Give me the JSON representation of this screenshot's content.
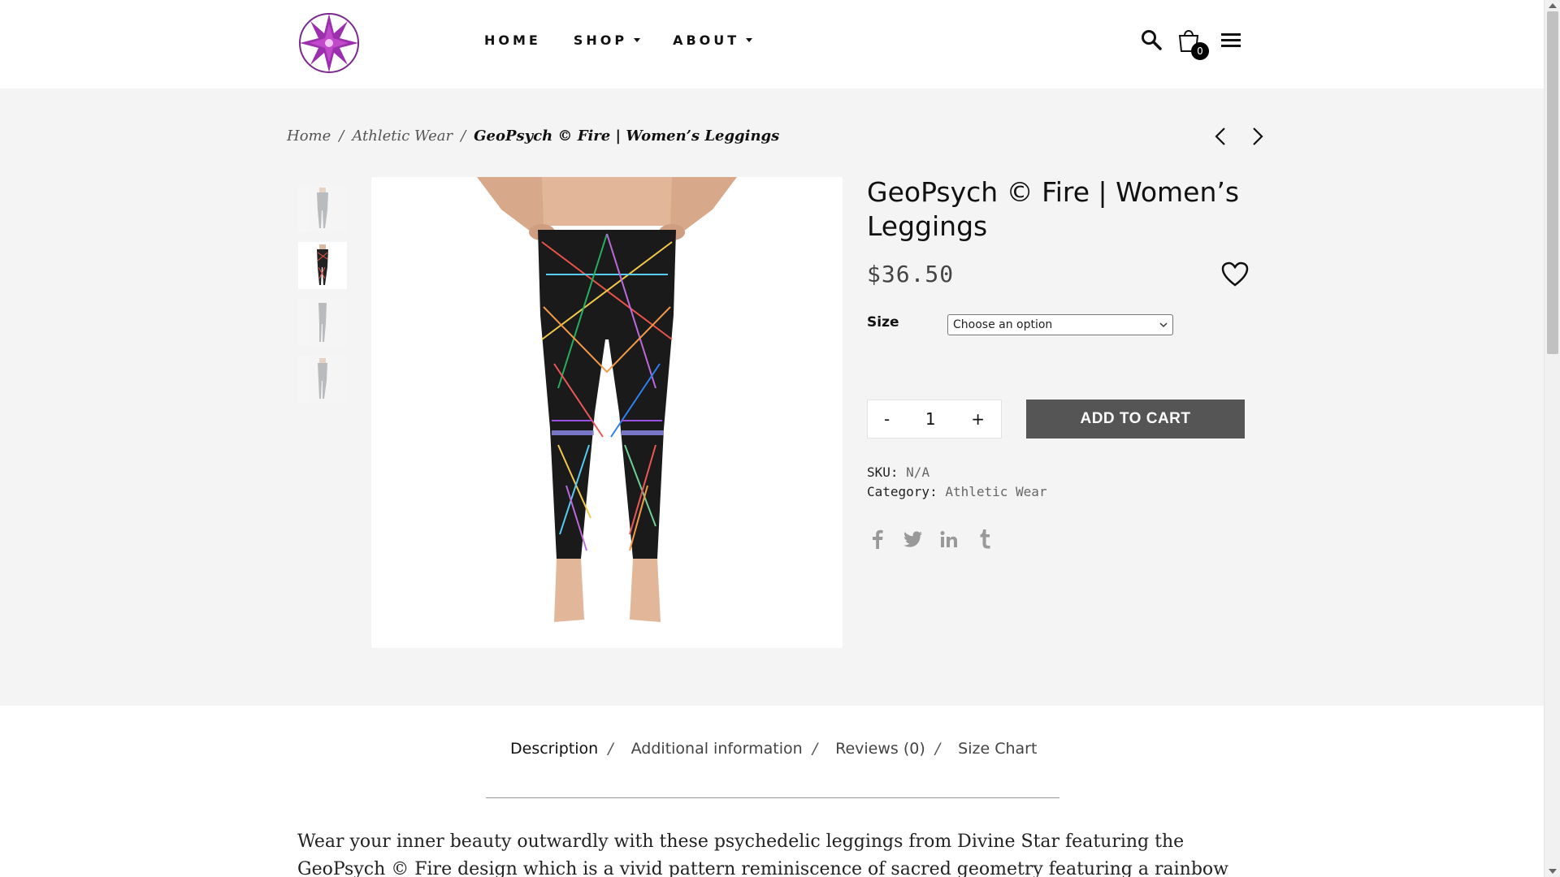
{
  "header": {
    "nav": [
      {
        "label": "HOME",
        "dropdown": false
      },
      {
        "label": "SHOP",
        "dropdown": true
      },
      {
        "label": "ABOUT",
        "dropdown": true
      }
    ],
    "cart_count": "0",
    "logo_colors": {
      "star": "#9b2fae",
      "accent": "#d45ad6"
    }
  },
  "breadcrumb": {
    "items": [
      "Home",
      "Athletic Wear"
    ],
    "separator": "/",
    "current": "GeoPsych © Fire | Women’s Leggings"
  },
  "product": {
    "title": "GeoPsych © Fire | Women’s Leggings",
    "price": "$36.50",
    "size_label": "Size",
    "size_select_value": "Choose an option",
    "quantity": "1",
    "qty_minus": "-",
    "qty_plus": "+",
    "add_to_cart": "ADD TO CART",
    "sku_label": "SKU:",
    "sku_value": "N/A",
    "category_label": "Category:",
    "category_value": "Athletic Wear",
    "social": [
      "facebook-icon",
      "twitter-icon",
      "linkedin-icon",
      "tumblr-icon"
    ],
    "thumbnails": 4
  },
  "tabs": {
    "items": [
      "Description",
      "Additional information",
      "Reviews (0)",
      "Size Chart"
    ],
    "active": "Description",
    "separator": "/"
  },
  "description": "Wear your inner beauty outwardly with these psychedelic leggings from Divine Star featuring the GeoPsych © Fire design which is a vivid pattern reminiscence of sacred geometry featuring a rainbow color scheme. Stylish,",
  "colors": {
    "button_bg": "#555555",
    "page_bg": "#f4f4f4"
  }
}
